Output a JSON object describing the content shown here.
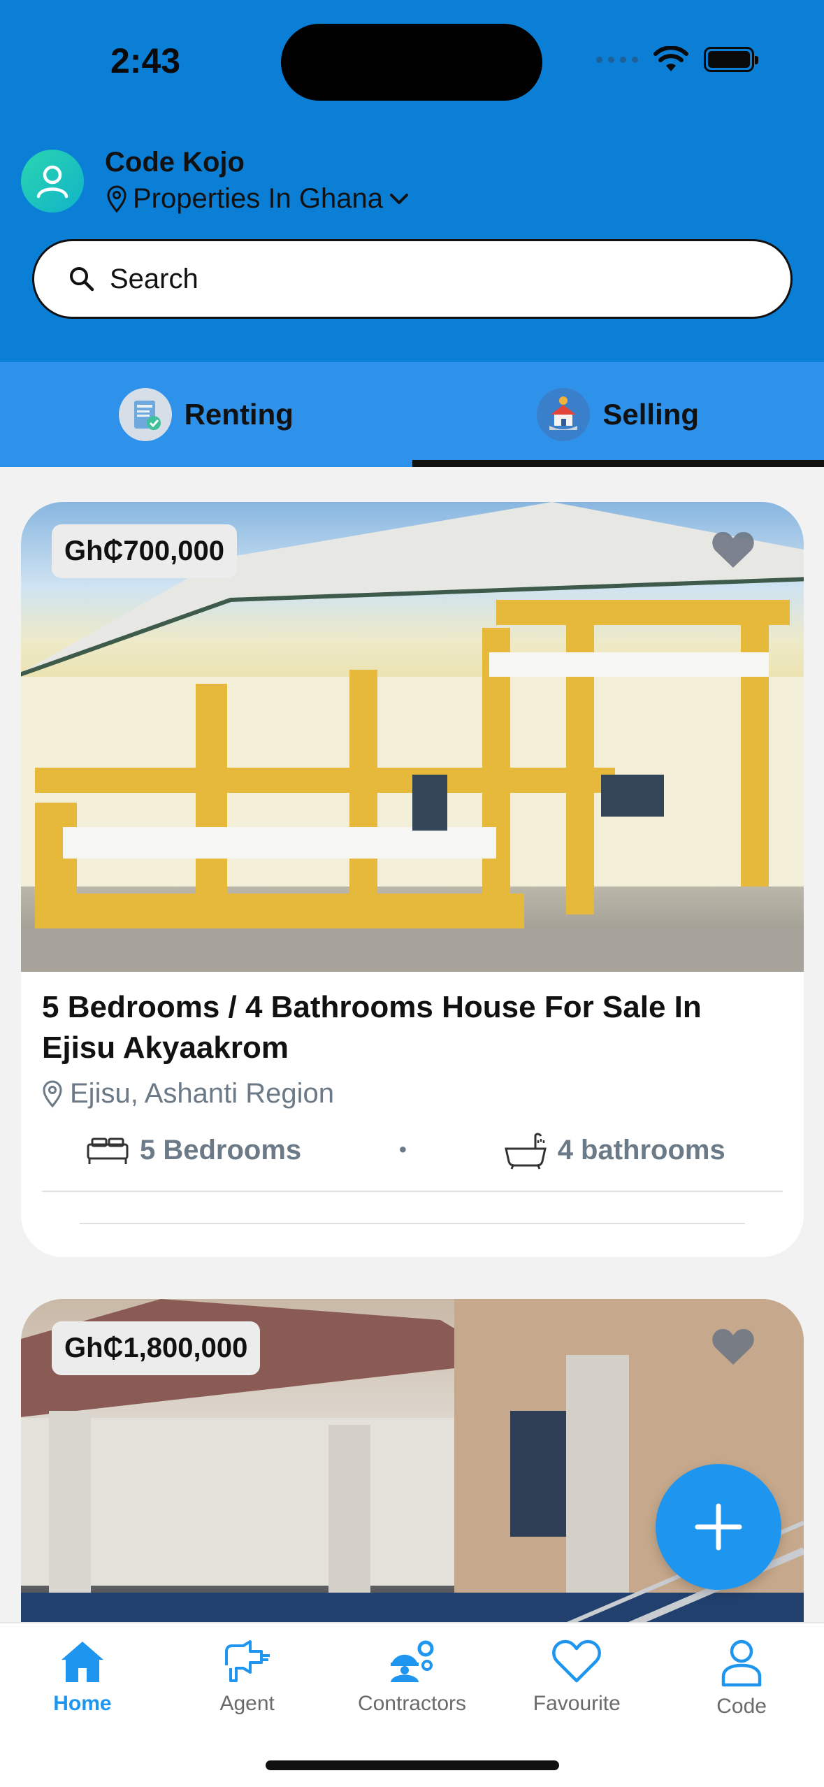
{
  "status": {
    "time": "2:43"
  },
  "user": {
    "name": "Code Kojo",
    "location": "Properties In Ghana"
  },
  "search": {
    "placeholder": "Search"
  },
  "tabs": [
    {
      "label": "Renting",
      "active": false
    },
    {
      "label": "Selling",
      "active": true
    }
  ],
  "listings": [
    {
      "price": "Gh₵700,000",
      "title": "5 Bedrooms / 4 Bathrooms House For Sale In Ejisu Akyaakrom",
      "location": "Ejisu, Ashanti Region",
      "bedrooms": "5 Bedrooms",
      "separator": "•",
      "bathrooms": "4 bathrooms"
    },
    {
      "price": "Gh₵1,800,000"
    }
  ],
  "nav": [
    {
      "label": "Home",
      "icon": "home-icon",
      "active": true
    },
    {
      "label": "Agent",
      "icon": "agent-icon",
      "active": false
    },
    {
      "label": "Contractors",
      "icon": "contractors-icon",
      "active": false
    },
    {
      "label": "Favourite",
      "icon": "heart-icon",
      "active": false
    },
    {
      "label": "Code",
      "icon": "profile-icon",
      "active": false
    }
  ],
  "colors": {
    "header": "#0b7fd6",
    "tabs": "#2f92ea",
    "accent": "#1e95ef"
  }
}
